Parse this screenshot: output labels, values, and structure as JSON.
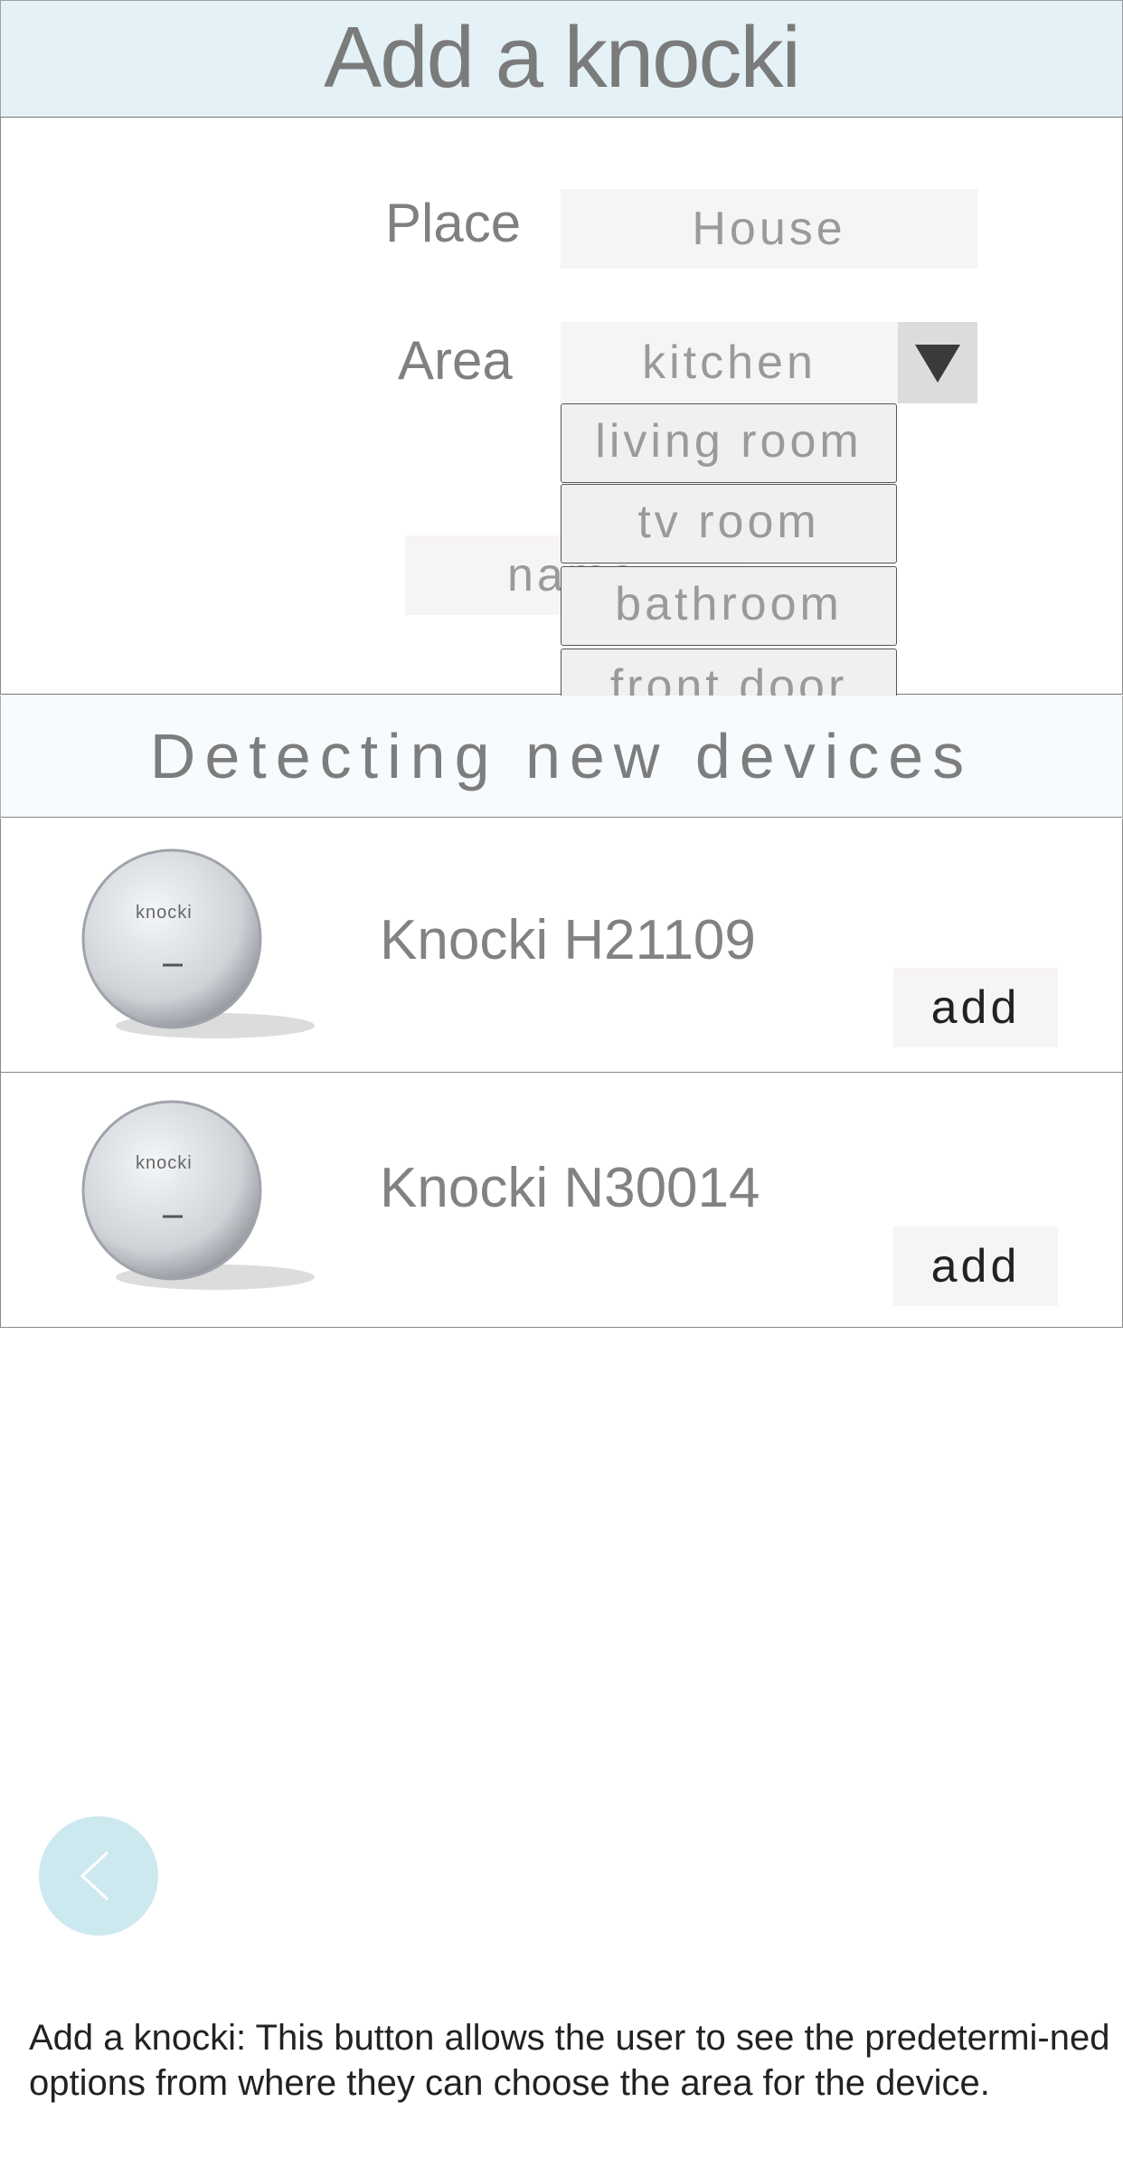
{
  "header": {
    "title": "Add a knocki"
  },
  "form": {
    "place_label": "Place",
    "place_value": "House",
    "area_label": "Area",
    "area_value": "kitchen",
    "name_placeholder": "name",
    "area_options": [
      "living room",
      "tv room",
      "bathroom",
      "front door"
    ]
  },
  "detect": {
    "title": "Detecting new devices",
    "devices": [
      {
        "logo": "knocki",
        "name": "Knocki H21109",
        "add_label": "add"
      },
      {
        "logo": "knocki",
        "name": "Knocki N30014",
        "add_label": "add"
      }
    ]
  },
  "nav": {
    "back_icon": "chevron-left-icon"
  },
  "caption": "Add a knocki: This button allows the user to see the predetermi-ned options from where they can choose the area for the device.",
  "colors": {
    "header_bg": "#e4f2f8",
    "back_button": "#cde9f0",
    "dropdown_option_bg": "#f1efef"
  }
}
